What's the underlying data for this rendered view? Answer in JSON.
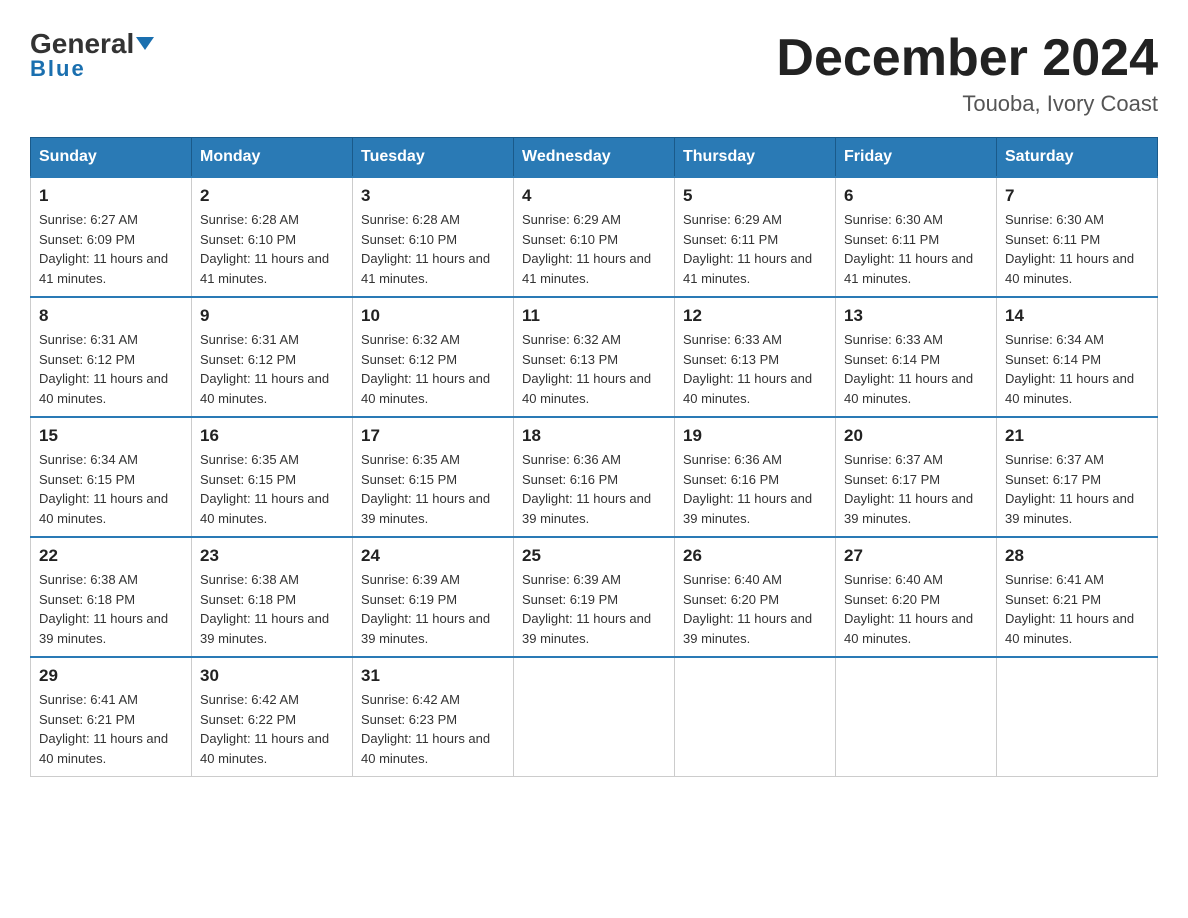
{
  "header": {
    "logo_text_general": "General",
    "logo_text_blue": "Blue",
    "month_title": "December 2024",
    "location": "Touoba, Ivory Coast"
  },
  "days_of_week": [
    "Sunday",
    "Monday",
    "Tuesday",
    "Wednesday",
    "Thursday",
    "Friday",
    "Saturday"
  ],
  "weeks": [
    [
      {
        "day": "1",
        "sunrise": "6:27 AM",
        "sunset": "6:09 PM",
        "daylight": "11 hours and 41 minutes."
      },
      {
        "day": "2",
        "sunrise": "6:28 AM",
        "sunset": "6:10 PM",
        "daylight": "11 hours and 41 minutes."
      },
      {
        "day": "3",
        "sunrise": "6:28 AM",
        "sunset": "6:10 PM",
        "daylight": "11 hours and 41 minutes."
      },
      {
        "day": "4",
        "sunrise": "6:29 AM",
        "sunset": "6:10 PM",
        "daylight": "11 hours and 41 minutes."
      },
      {
        "day": "5",
        "sunrise": "6:29 AM",
        "sunset": "6:11 PM",
        "daylight": "11 hours and 41 minutes."
      },
      {
        "day": "6",
        "sunrise": "6:30 AM",
        "sunset": "6:11 PM",
        "daylight": "11 hours and 41 minutes."
      },
      {
        "day": "7",
        "sunrise": "6:30 AM",
        "sunset": "6:11 PM",
        "daylight": "11 hours and 40 minutes."
      }
    ],
    [
      {
        "day": "8",
        "sunrise": "6:31 AM",
        "sunset": "6:12 PM",
        "daylight": "11 hours and 40 minutes."
      },
      {
        "day": "9",
        "sunrise": "6:31 AM",
        "sunset": "6:12 PM",
        "daylight": "11 hours and 40 minutes."
      },
      {
        "day": "10",
        "sunrise": "6:32 AM",
        "sunset": "6:12 PM",
        "daylight": "11 hours and 40 minutes."
      },
      {
        "day": "11",
        "sunrise": "6:32 AM",
        "sunset": "6:13 PM",
        "daylight": "11 hours and 40 minutes."
      },
      {
        "day": "12",
        "sunrise": "6:33 AM",
        "sunset": "6:13 PM",
        "daylight": "11 hours and 40 minutes."
      },
      {
        "day": "13",
        "sunrise": "6:33 AM",
        "sunset": "6:14 PM",
        "daylight": "11 hours and 40 minutes."
      },
      {
        "day": "14",
        "sunrise": "6:34 AM",
        "sunset": "6:14 PM",
        "daylight": "11 hours and 40 minutes."
      }
    ],
    [
      {
        "day": "15",
        "sunrise": "6:34 AM",
        "sunset": "6:15 PM",
        "daylight": "11 hours and 40 minutes."
      },
      {
        "day": "16",
        "sunrise": "6:35 AM",
        "sunset": "6:15 PM",
        "daylight": "11 hours and 40 minutes."
      },
      {
        "day": "17",
        "sunrise": "6:35 AM",
        "sunset": "6:15 PM",
        "daylight": "11 hours and 39 minutes."
      },
      {
        "day": "18",
        "sunrise": "6:36 AM",
        "sunset": "6:16 PM",
        "daylight": "11 hours and 39 minutes."
      },
      {
        "day": "19",
        "sunrise": "6:36 AM",
        "sunset": "6:16 PM",
        "daylight": "11 hours and 39 minutes."
      },
      {
        "day": "20",
        "sunrise": "6:37 AM",
        "sunset": "6:17 PM",
        "daylight": "11 hours and 39 minutes."
      },
      {
        "day": "21",
        "sunrise": "6:37 AM",
        "sunset": "6:17 PM",
        "daylight": "11 hours and 39 minutes."
      }
    ],
    [
      {
        "day": "22",
        "sunrise": "6:38 AM",
        "sunset": "6:18 PM",
        "daylight": "11 hours and 39 minutes."
      },
      {
        "day": "23",
        "sunrise": "6:38 AM",
        "sunset": "6:18 PM",
        "daylight": "11 hours and 39 minutes."
      },
      {
        "day": "24",
        "sunrise": "6:39 AM",
        "sunset": "6:19 PM",
        "daylight": "11 hours and 39 minutes."
      },
      {
        "day": "25",
        "sunrise": "6:39 AM",
        "sunset": "6:19 PM",
        "daylight": "11 hours and 39 minutes."
      },
      {
        "day": "26",
        "sunrise": "6:40 AM",
        "sunset": "6:20 PM",
        "daylight": "11 hours and 39 minutes."
      },
      {
        "day": "27",
        "sunrise": "6:40 AM",
        "sunset": "6:20 PM",
        "daylight": "11 hours and 40 minutes."
      },
      {
        "day": "28",
        "sunrise": "6:41 AM",
        "sunset": "6:21 PM",
        "daylight": "11 hours and 40 minutes."
      }
    ],
    [
      {
        "day": "29",
        "sunrise": "6:41 AM",
        "sunset": "6:21 PM",
        "daylight": "11 hours and 40 minutes."
      },
      {
        "day": "30",
        "sunrise": "6:42 AM",
        "sunset": "6:22 PM",
        "daylight": "11 hours and 40 minutes."
      },
      {
        "day": "31",
        "sunrise": "6:42 AM",
        "sunset": "6:23 PM",
        "daylight": "11 hours and 40 minutes."
      },
      null,
      null,
      null,
      null
    ]
  ]
}
